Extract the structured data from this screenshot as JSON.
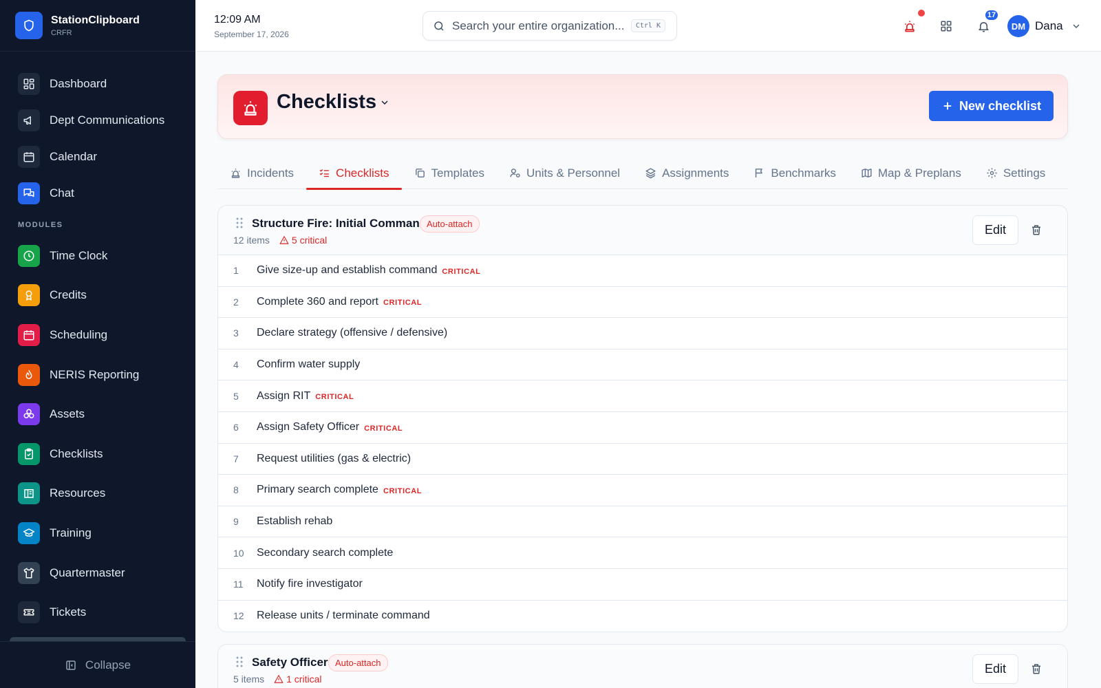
{
  "brand": {
    "name": "StationClipboard",
    "sub": "CRFR"
  },
  "nav": {
    "main": [
      {
        "label": "Dashboard",
        "icon": "dashboard-icon"
      },
      {
        "label": "Dept Communications",
        "icon": "megaphone-icon"
      },
      {
        "label": "Calendar",
        "icon": "calendar-icon"
      },
      {
        "label": "Chat",
        "icon": "chat-icon"
      }
    ],
    "modules_label": "MODULES",
    "modules": [
      {
        "label": "Time Clock",
        "icon": "clock-icon",
        "color": "#16a34a"
      },
      {
        "label": "Credits",
        "icon": "award-icon",
        "color": "#f59e0b"
      },
      {
        "label": "Scheduling",
        "icon": "calendar-icon",
        "color": "#e11d48"
      },
      {
        "label": "NERIS Reporting",
        "icon": "flame-icon",
        "color": "#ea580c"
      },
      {
        "label": "Assets",
        "icon": "boxes-icon",
        "color": "#7c3aed"
      },
      {
        "label": "Checklists",
        "icon": "clipboard-check-icon",
        "color": "#059669"
      },
      {
        "label": "Resources",
        "icon": "book-icon",
        "color": "#0d9488"
      },
      {
        "label": "Training",
        "icon": "graduation-cap-icon",
        "color": "#0284c7"
      },
      {
        "label": "Quartermaster",
        "icon": "shirt-icon",
        "color": "#334155"
      },
      {
        "label": "Tickets",
        "icon": "ticket-icon",
        "color": "#1e293b"
      }
    ],
    "collapse_label": "Collapse"
  },
  "topbar": {
    "time": "12:09 AM",
    "date": "September 17, 2026",
    "search_placeholder": "Search your entire organization...",
    "search_shortcut": "Ctrl K",
    "notification_count": "17",
    "user_initials": "DM",
    "user_name": "Dana"
  },
  "header": {
    "title": "Checklists",
    "new_button": "New checklist"
  },
  "tabs": [
    {
      "label": "Incidents",
      "icon": "siren-icon",
      "active": false
    },
    {
      "label": "Checklists",
      "icon": "list-checks-icon",
      "active": true
    },
    {
      "label": "Templates",
      "icon": "copy-icon",
      "active": false
    },
    {
      "label": "Units & Personnel",
      "icon": "user-cog-icon",
      "active": false
    },
    {
      "label": "Assignments",
      "icon": "layers-icon",
      "active": false
    },
    {
      "label": "Benchmarks",
      "icon": "flag-icon",
      "active": false
    },
    {
      "label": "Map & Preplans",
      "icon": "map-icon",
      "active": false
    },
    {
      "label": "Settings",
      "icon": "gear-icon",
      "active": false
    }
  ],
  "checklists": [
    {
      "title": "Structure Fire: Initial Command",
      "badge": "Auto-attach",
      "items_count": "12 items",
      "critical_count": "5 critical",
      "edit_label": "Edit",
      "items": [
        {
          "num": "1",
          "text": "Give size-up and establish command",
          "critical": "CRITICAL"
        },
        {
          "num": "2",
          "text": "Complete 360 and report",
          "critical": "CRITICAL"
        },
        {
          "num": "3",
          "text": "Declare strategy (offensive / defensive)",
          "critical": ""
        },
        {
          "num": "4",
          "text": "Confirm water supply",
          "critical": ""
        },
        {
          "num": "5",
          "text": "Assign RIT",
          "critical": "CRITICAL"
        },
        {
          "num": "6",
          "text": "Assign Safety Officer",
          "critical": "CRITICAL"
        },
        {
          "num": "7",
          "text": "Request utilities (gas & electric)",
          "critical": ""
        },
        {
          "num": "8",
          "text": "Primary search complete",
          "critical": "CRITICAL"
        },
        {
          "num": "9",
          "text": "Establish rehab",
          "critical": ""
        },
        {
          "num": "10",
          "text": "Secondary search complete",
          "critical": ""
        },
        {
          "num": "11",
          "text": "Notify fire investigator",
          "critical": ""
        },
        {
          "num": "12",
          "text": "Release units / terminate command",
          "critical": ""
        }
      ]
    },
    {
      "title": "Safety Officer",
      "badge": "Auto-attach",
      "items_count": "5 items",
      "critical_count": "1 critical",
      "edit_label": "Edit",
      "items": []
    }
  ],
  "colors": {
    "accent": "#2563eb",
    "critical": "#dc2626",
    "sidebar": "#0f172a"
  }
}
